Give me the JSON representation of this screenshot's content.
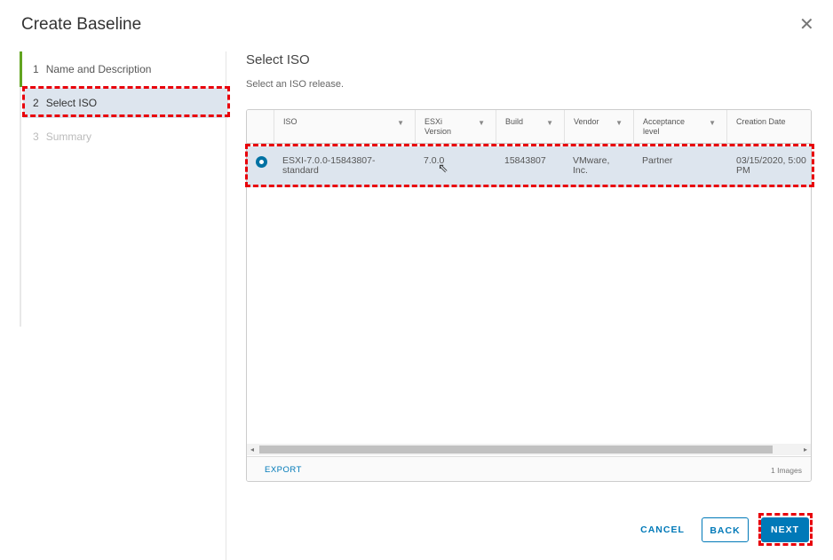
{
  "dialog": {
    "title": "Create Baseline",
    "close_icon": "close-icon"
  },
  "steps": [
    {
      "num": "1",
      "label": "Name and Description"
    },
    {
      "num": "2",
      "label": "Select ISO"
    },
    {
      "num": "3",
      "label": "Summary"
    }
  ],
  "page": {
    "title": "Select ISO",
    "subtitle": "Select an ISO release."
  },
  "table": {
    "columns": [
      "ISO",
      "ESXi\nVersion",
      "Build",
      "Vendor",
      "Acceptance\nlevel",
      "Creation Date"
    ],
    "rows": [
      {
        "iso": "ESXI-7.0.0-15843807-standard",
        "version": "7.0.0",
        "build": "15843807",
        "vendor": "VMware, Inc.",
        "acceptance": "Partner",
        "created": "03/15/2020, 5:00 PM",
        "selected": true
      }
    ],
    "export_label": "EXPORT",
    "count": "1 Images"
  },
  "buttons": {
    "cancel": "CANCEL",
    "back": "BACK",
    "next": "NEXT"
  },
  "colors": {
    "accent": "#0079b8",
    "highlight": "#e8000b",
    "done": "#62a420"
  }
}
